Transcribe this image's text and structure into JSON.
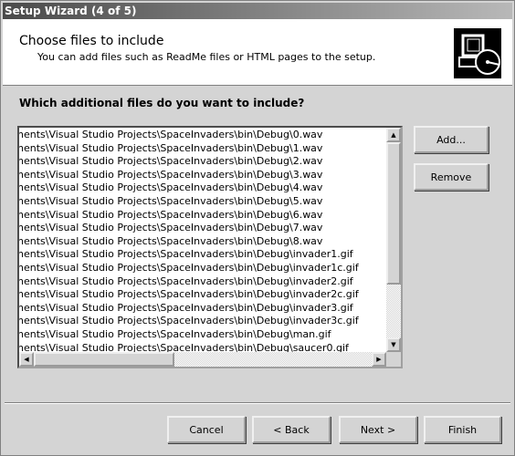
{
  "window": {
    "title": "Setup Wizard (4 of 5)"
  },
  "header": {
    "title": "Choose files to include",
    "subtitle": "You can add files such as ReadMe files or HTML pages to the setup.",
    "icon": "computer-disk-icon"
  },
  "question": "Which additional files do you want to include?",
  "files": [
    "nents\\Visual Studio Projects\\SpaceInvaders\\bin\\Debug\\0.wav",
    "nents\\Visual Studio Projects\\SpaceInvaders\\bin\\Debug\\1.wav",
    "nents\\Visual Studio Projects\\SpaceInvaders\\bin\\Debug\\2.wav",
    "nents\\Visual Studio Projects\\SpaceInvaders\\bin\\Debug\\3.wav",
    "nents\\Visual Studio Projects\\SpaceInvaders\\bin\\Debug\\4.wav",
    "nents\\Visual Studio Projects\\SpaceInvaders\\bin\\Debug\\5.wav",
    "nents\\Visual Studio Projects\\SpaceInvaders\\bin\\Debug\\6.wav",
    "nents\\Visual Studio Projects\\SpaceInvaders\\bin\\Debug\\7.wav",
    "nents\\Visual Studio Projects\\SpaceInvaders\\bin\\Debug\\8.wav",
    "nents\\Visual Studio Projects\\SpaceInvaders\\bin\\Debug\\invader1.gif",
    "nents\\Visual Studio Projects\\SpaceInvaders\\bin\\Debug\\invader1c.gif",
    "nents\\Visual Studio Projects\\SpaceInvaders\\bin\\Debug\\invader2.gif",
    "nents\\Visual Studio Projects\\SpaceInvaders\\bin\\Debug\\invader2c.gif",
    "nents\\Visual Studio Projects\\SpaceInvaders\\bin\\Debug\\invader3.gif",
    "nents\\Visual Studio Projects\\SpaceInvaders\\bin\\Debug\\invader3c.gif",
    "nents\\Visual Studio Projects\\SpaceInvaders\\bin\\Debug\\man.gif",
    "nents\\Visual Studio Projects\\SpaceInvaders\\bin\\Debug\\saucer0.gif"
  ],
  "buttons": {
    "add": "Add...",
    "remove": "Remove",
    "cancel": "Cancel",
    "back": "< Back",
    "next": "Next >",
    "finish": "Finish"
  }
}
